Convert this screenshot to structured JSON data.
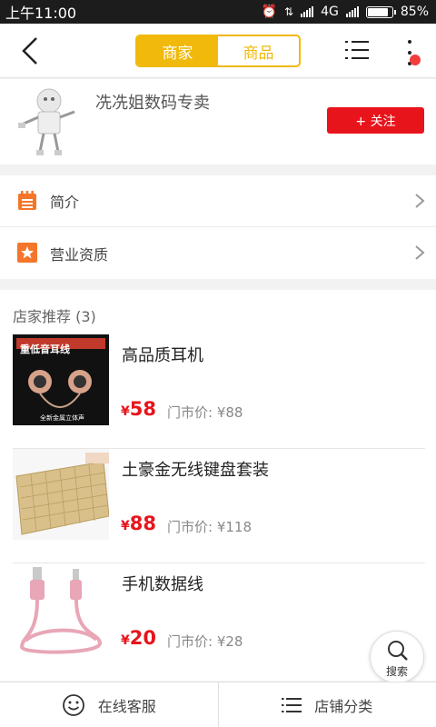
{
  "status": {
    "time": "上午11:00",
    "network": "4G",
    "battery": "85%",
    "battery_level": 0.85
  },
  "nav": {
    "tab_shop": "商家",
    "tab_goods": "商品"
  },
  "shop": {
    "name": "冼冼姐数码专卖",
    "follow_label": "+ 关注"
  },
  "links": [
    {
      "label": "简介",
      "icon": "notepad-icon",
      "color": "#f5762a"
    },
    {
      "label": "营业资质",
      "icon": "star-badge-icon",
      "color": "#f5762a"
    }
  ],
  "recommend": {
    "title": "店家推荐 (3)",
    "items": [
      {
        "title": "高品质耳机",
        "currency": "¥",
        "price": "58",
        "original": "门市价: ¥88",
        "image": "earphones-image"
      },
      {
        "title": "土豪金无线键盘套装",
        "currency": "¥",
        "price": "88",
        "original": "门市价: ¥118",
        "image": "keyboard-image"
      },
      {
        "title": "手机数据线",
        "currency": "¥",
        "price": "20",
        "original": "门市价: ¥28",
        "image": "cable-image"
      }
    ],
    "earphone_box_text": [
      "重低音耳线",
      "全新金属立体声"
    ]
  },
  "search_label": "搜索",
  "bottom": {
    "service_label": "在线客服",
    "category_label": "店铺分类"
  },
  "colors": {
    "accent": "#f0b90b",
    "price_red": "#e8141c",
    "icon_orange": "#f5762a"
  }
}
